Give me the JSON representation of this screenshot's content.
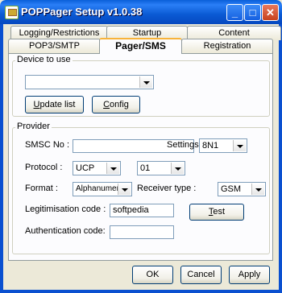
{
  "window": {
    "title": "POPPager Setup v1.0.38"
  },
  "tabs_back": [
    "Logging/Restrictions",
    "Startup",
    "Content"
  ],
  "tabs_front": [
    "POP3/SMTP",
    "Pager/SMS",
    "Registration"
  ],
  "device": {
    "group_label": "Device to use",
    "device_value": "",
    "update_prefix": "U",
    "update_rest": "pdate list",
    "config_prefix": "C",
    "config_rest": "onfig"
  },
  "provider": {
    "group_label": "Provider",
    "smsc_label": "SMSC No :",
    "smsc_value": "",
    "settings_label": "Settings :",
    "settings_value": "8N1",
    "protocol_label": "Protocol :",
    "protocol_value": "UCP",
    "protocol_sub_value": "01",
    "format_label": "Format :",
    "format_value": "Alphanumeric",
    "receiver_label": "Receiver type :",
    "receiver_value": "GSM",
    "legit_label": "Legitimisation code :",
    "legit_value": "softpedia",
    "test_prefix": "T",
    "test_rest": "est",
    "auth_label": "Authentication code:",
    "auth_value": ""
  },
  "footer": {
    "ok": "OK",
    "cancel": "Cancel",
    "apply": "Apply"
  }
}
